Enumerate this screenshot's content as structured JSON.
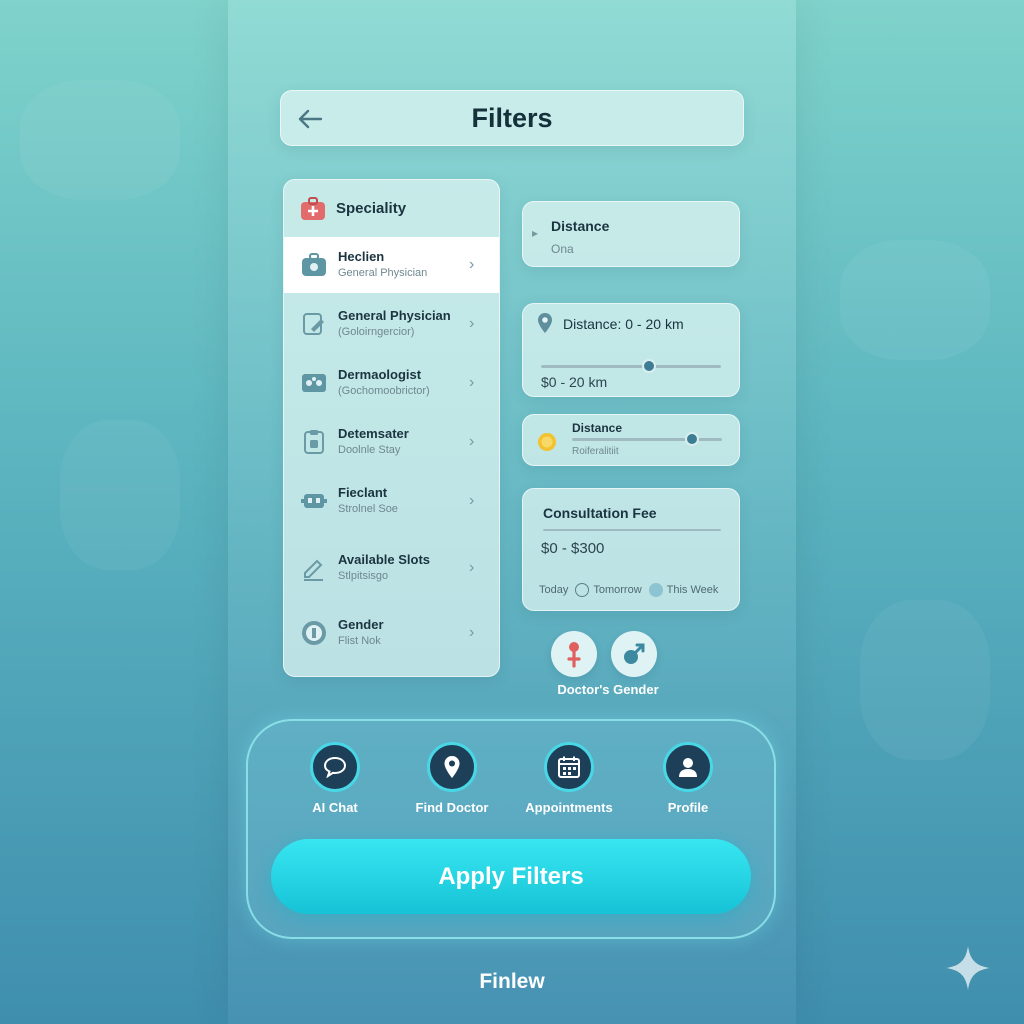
{
  "header": {
    "title": "Filters"
  },
  "speciality": {
    "heading": "Speciality",
    "items": [
      {
        "title": "Heclien",
        "subtitle": "General Physician",
        "icon": "medical-bag-icon"
      },
      {
        "title": "General Physician",
        "subtitle": "(Goloirngercior)",
        "icon": "document-edit-icon"
      },
      {
        "title": "Dermaologist",
        "subtitle": "(Gochomoobrictor)",
        "icon": "skin-icon"
      },
      {
        "title": "Detemsater",
        "subtitle": "Doolnle Stay",
        "icon": "clipboard-icon"
      },
      {
        "title": "Fieclant",
        "subtitle": "Strolnel Soe",
        "icon": "device-icon"
      },
      {
        "title": "Available Slots",
        "subtitle": "Stlpitsisgo",
        "icon": "pencil-icon"
      },
      {
        "title": "Gender",
        "subtitle": "Flist Nok",
        "icon": "gender-icon"
      }
    ]
  },
  "distance_card": {
    "title": "Distance",
    "subtitle": "Ona"
  },
  "distance_range": {
    "title": "Distance: 0 - 20 km",
    "value_label": "$0 - 20 km",
    "value_fraction": 0.6
  },
  "distance_small": {
    "title": "Distance",
    "subtitle": "Roiferalitiit",
    "value_fraction": 0.8
  },
  "consultation": {
    "title": "Consultation Fee",
    "range": "$0 - $300",
    "options": [
      {
        "label": "Today"
      },
      {
        "label": "Tomorrow"
      },
      {
        "label": "This Week"
      }
    ]
  },
  "gender": {
    "label": "Doctor's Gender"
  },
  "nav": [
    {
      "label": "AI Chat",
      "icon": "chat-icon"
    },
    {
      "label": "Find Doctor",
      "icon": "location-pin-icon"
    },
    {
      "label": "Appointments",
      "icon": "calendar-icon"
    },
    {
      "label": "Profile",
      "icon": "user-icon"
    }
  ],
  "apply_label": "Apply Filters",
  "footer": "Finlew",
  "colors": {
    "accent": "#1fd0e0",
    "nav_bg": "#1d3f58",
    "fee_icon": "#f2c230",
    "female": "#e06060"
  }
}
